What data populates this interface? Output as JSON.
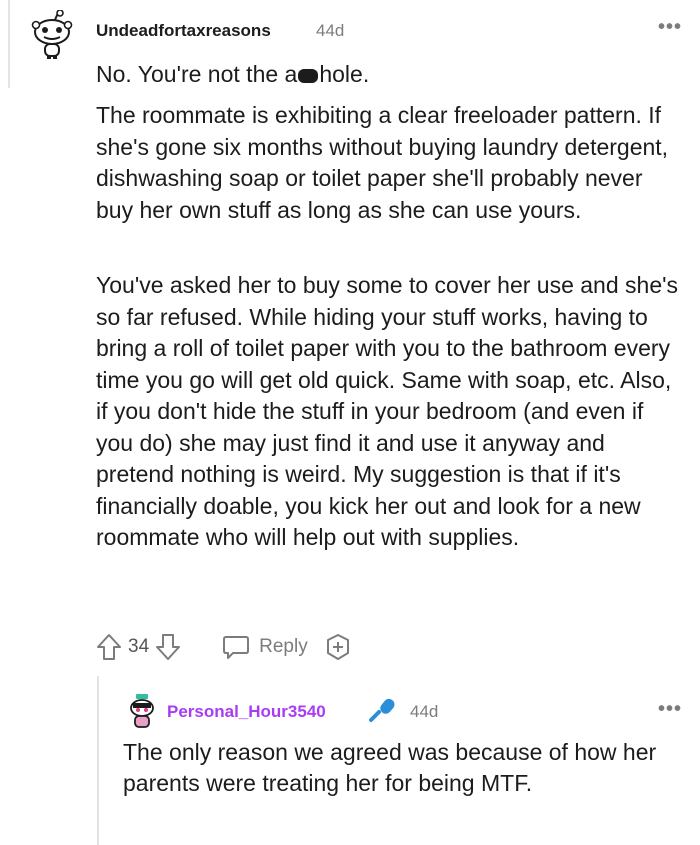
{
  "comment": {
    "username": "Undeadfortaxreasons",
    "age": "44d",
    "more_label": "•••",
    "first_line_before": "No. You're not the a",
    "first_line_after": "hole.",
    "paragraph_1": "The roommate is exhibiting a clear freeloader pattern. If she's gone six months without buying laundry detergent, dishwashing soap or toilet paper she'll probably never buy her own stuff as long as she can use yours.",
    "paragraph_2": "You've asked her to buy some to cover her use and she's so far refused. While hiding your stuff works, having to bring a roll of toilet paper with you to the bathroom every time you go will get old quick. Same with soap, etc. Also, if you don't hide the stuff in your bedroom (and even if you do) she may just find it and use it anyway and pretend nothing is weird. My suggestion is that if it's financially doable, you kick her out and look for a new roommate who will help out with supplies.",
    "vote_count": "34",
    "reply_label": "Reply"
  },
  "reply": {
    "username": "Personal_Hour3540",
    "username_color": "#a83cf5",
    "age": "44d",
    "more_label": "•••",
    "body": "The only reason we agreed was because of how her parents were treating her for being MTF."
  },
  "icons": [
    "snoo-avatar-icon",
    "more-options-icon",
    "upvote-icon",
    "downvote-icon",
    "reply-icon",
    "award-icon",
    "microphone-icon",
    "reply-avatar-icon"
  ]
}
